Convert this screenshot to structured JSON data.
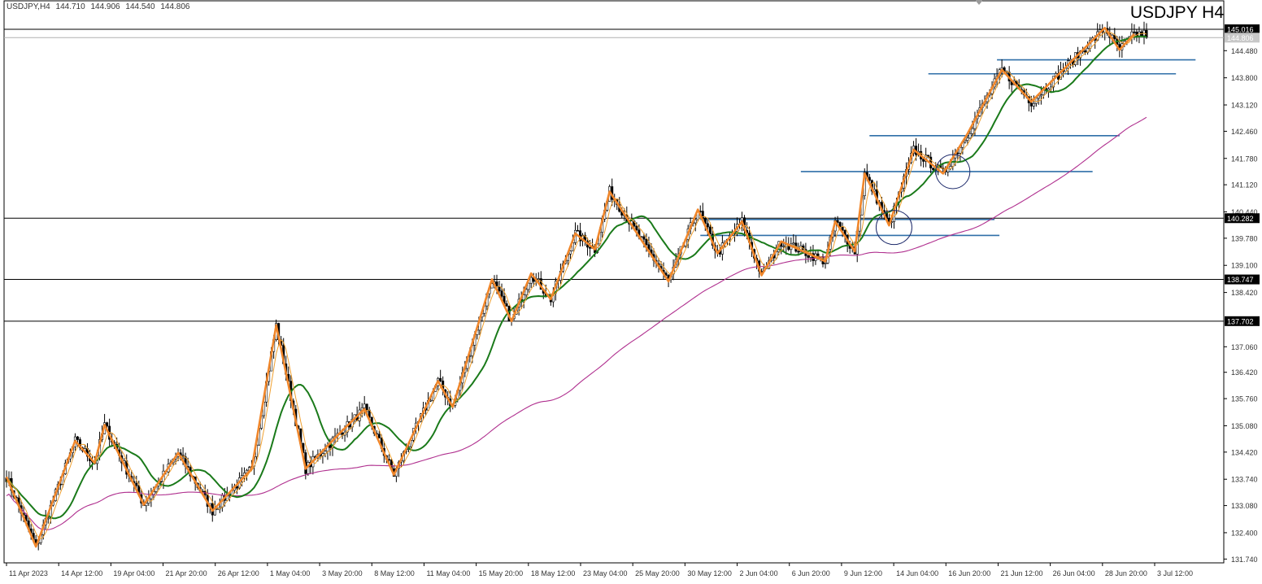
{
  "header": {
    "symbol": "USDJPY,H4",
    "open": "144.710",
    "high": "144.906",
    "low": "144.540",
    "close": "144.806"
  },
  "title": "USDJPY H4",
  "price_axis": {
    "labels": [
      "144.480",
      "143.800",
      "143.120",
      "142.460",
      "141.780",
      "141.120",
      "140.440",
      "139.780",
      "139.100",
      "138.420",
      "137.060",
      "136.420",
      "135.760",
      "135.080",
      "134.420",
      "133.740",
      "133.080",
      "132.400",
      "131.740"
    ]
  },
  "time_axis": {
    "labels": [
      "11 Apr 2023",
      "14 Apr 12:00",
      "19 Apr 04:00",
      "21 Apr 20:00",
      "26 Apr 12:00",
      "1 May 04:00",
      "3 May 20:00",
      "8 May 12:00",
      "11 May 04:00",
      "15 May 20:00",
      "18 May 12:00",
      "23 May 04:00",
      "25 May 20:00",
      "30 May 12:00",
      "2 Jun 04:00",
      "6 Jun 20:00",
      "9 Jun 12:00",
      "14 Jun 04:00",
      "16 Jun 20:00",
      "21 Jun 12:00",
      "26 Jun 04:00",
      "28 Jun 20:00",
      "3 Jul 12:00"
    ]
  },
  "levels": [
    {
      "price": "145.016",
      "dark": true
    },
    {
      "price": "144.806",
      "dark": false
    },
    {
      "price": "140.282",
      "dark": true
    },
    {
      "price": "138.747",
      "dark": true
    },
    {
      "price": "137.702",
      "dark": true
    }
  ],
  "colors": {
    "candle": "#000000",
    "zigzag": "#f0862a",
    "ma_fast": "#f0a030",
    "ma_mid": "#1a7a1a",
    "ma_slow": "#b0308f",
    "support": "#2f6fa8",
    "level": "#000000"
  },
  "chart_data": {
    "type": "candlestick",
    "symbol": "USDJPY",
    "timeframe": "H4",
    "ylim": [
      131.74,
      145.3
    ],
    "zigzag": [
      {
        "i": 0,
        "p": 133.8
      },
      {
        "i": 12,
        "p": 132.05
      },
      {
        "i": 28,
        "p": 134.7
      },
      {
        "i": 36,
        "p": 134.15
      },
      {
        "i": 40,
        "p": 135.1
      },
      {
        "i": 56,
        "p": 133.1
      },
      {
        "i": 70,
        "p": 134.4
      },
      {
        "i": 84,
        "p": 132.95
      },
      {
        "i": 100,
        "p": 134.0
      },
      {
        "i": 110,
        "p": 137.6
      },
      {
        "i": 122,
        "p": 134.0
      },
      {
        "i": 136,
        "p": 134.9
      },
      {
        "i": 146,
        "p": 135.5
      },
      {
        "i": 158,
        "p": 133.85
      },
      {
        "i": 176,
        "p": 136.2
      },
      {
        "i": 182,
        "p": 135.55
      },
      {
        "i": 198,
        "p": 138.75
      },
      {
        "i": 206,
        "p": 137.7
      },
      {
        "i": 214,
        "p": 138.9
      },
      {
        "i": 222,
        "p": 138.25
      },
      {
        "i": 232,
        "p": 139.9
      },
      {
        "i": 240,
        "p": 139.5
      },
      {
        "i": 246,
        "p": 140.95
      },
      {
        "i": 270,
        "p": 138.7
      },
      {
        "i": 282,
        "p": 140.5
      },
      {
        "i": 290,
        "p": 139.4
      },
      {
        "i": 300,
        "p": 140.2
      },
      {
        "i": 308,
        "p": 138.85
      },
      {
        "i": 316,
        "p": 139.7
      },
      {
        "i": 334,
        "p": 139.2
      },
      {
        "i": 338,
        "p": 140.2
      },
      {
        "i": 346,
        "p": 139.45
      },
      {
        "i": 350,
        "p": 141.4
      },
      {
        "i": 354,
        "p": 140.9
      },
      {
        "i": 360,
        "p": 140.1
      },
      {
        "i": 370,
        "p": 142.0
      },
      {
        "i": 382,
        "p": 141.4
      },
      {
        "i": 392,
        "p": 142.4
      },
      {
        "i": 406,
        "p": 144.0
      },
      {
        "i": 418,
        "p": 143.2
      },
      {
        "i": 448,
        "p": 145.05
      },
      {
        "i": 454,
        "p": 144.5
      },
      {
        "i": 460,
        "p": 144.9
      }
    ],
    "supports": [
      {
        "price": 144.25,
        "from": 404,
        "to": 485
      },
      {
        "price": 143.9,
        "from": 376,
        "to": 477
      },
      {
        "price": 142.35,
        "from": 352,
        "to": 454
      },
      {
        "price": 141.45,
        "from": 324,
        "to": 443
      },
      {
        "price": 140.25,
        "from": 283,
        "to": 403
      },
      {
        "price": 139.85,
        "from": 283,
        "to": 405
      }
    ]
  }
}
